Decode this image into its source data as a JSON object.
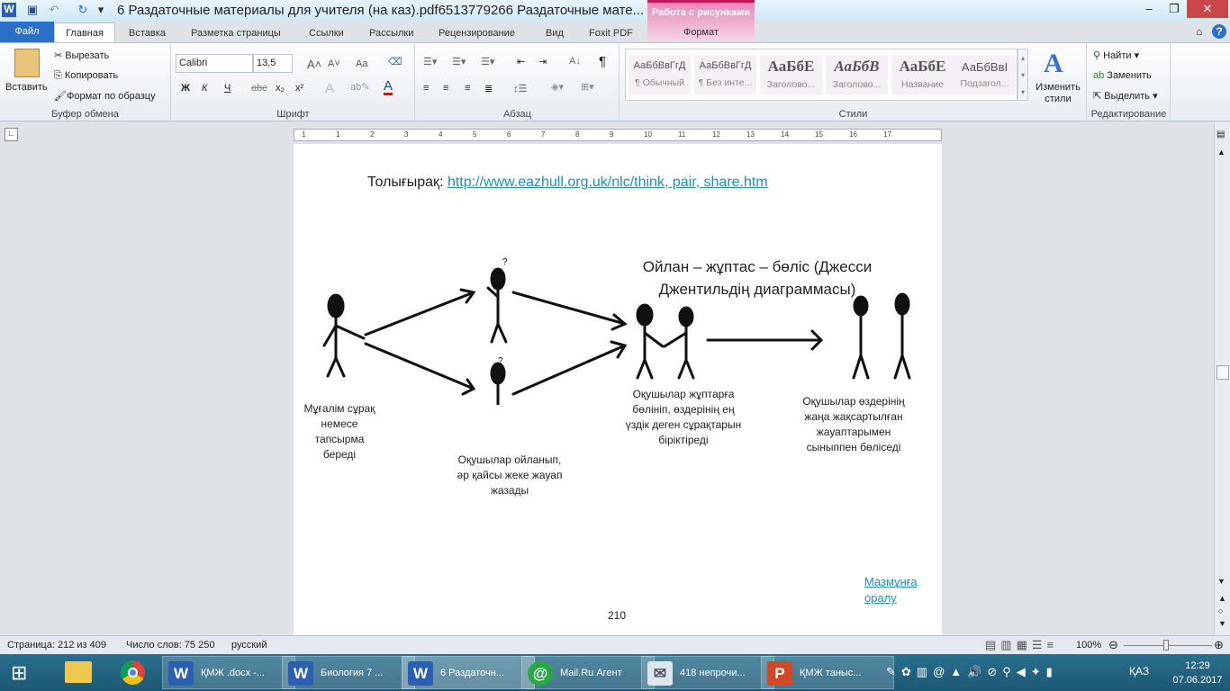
{
  "window": {
    "title": "6 Раздаточные материалы для учителя (на каз).pdf6513779266 Раздаточные мате...",
    "context_tab_group": "Работа с рисунками",
    "context_tab": "Формат",
    "app_icon": "word-icon",
    "minimize": "–",
    "restore": "❐",
    "close": "✕"
  },
  "tabs": [
    {
      "label": "Файл"
    },
    {
      "label": "Главная"
    },
    {
      "label": "Вставка"
    },
    {
      "label": "Разметка страницы"
    },
    {
      "label": "Ссылки"
    },
    {
      "label": "Рассылки"
    },
    {
      "label": "Рецензирование"
    },
    {
      "label": "Вид"
    },
    {
      "label": "Foxit PDF"
    }
  ],
  "ribbon": {
    "clipboard": {
      "label": "Буфер обмена",
      "paste": "Вставить",
      "cut": "Вырезать",
      "copy": "Копировать",
      "format_painter": "Формат по образцу"
    },
    "font": {
      "label": "Шрифт",
      "font_name": "Calibri",
      "font_size": "13,5",
      "bold": "Ж",
      "italic": "К",
      "underline": "Ч",
      "strike": "abc",
      "sub": "x₂",
      "sup": "x²",
      "grow": "A˄",
      "shrink": "A˅",
      "case": "Aa",
      "font_color": "A",
      "font_color_hex": "#e01010"
    },
    "paragraph": {
      "label": "Абзац",
      "pilcrow": "¶"
    },
    "styles": {
      "label": "Стили",
      "items": [
        {
          "sample": "АаБбВвГгД",
          "name": "¶ Обычный"
        },
        {
          "sample": "АаБбВвГгД",
          "name": "¶ Без инте..."
        },
        {
          "sample": "АаБбЕ",
          "name": "Заголово..."
        },
        {
          "sample": "АаБбВ",
          "name": "Заголово..."
        },
        {
          "sample": "АаБбЕ",
          "name": "Название"
        },
        {
          "sample": "АаБбВвІ",
          "name": "Подзагол..."
        }
      ],
      "change_styles": "Изменить стили"
    },
    "editing": {
      "label": "Редактирование",
      "find": "Найти",
      "replace": "Заменить",
      "select": "Выделить"
    }
  },
  "ruler": {
    "ticks": [
      "1",
      "1",
      "2",
      "3",
      "4",
      "5",
      "6",
      "7",
      "8",
      "9",
      "10",
      "11",
      "12",
      "13",
      "14",
      "15",
      "16",
      "17"
    ]
  },
  "document": {
    "more_label": "Толығырақ:",
    "more_link": "http://www.eazhull.org.uk/nlc/think, pair, share.htm",
    "diagram_title_1": "Ойлан – жұптас – бөліс (Джесси",
    "diagram_title_2": "Джентильдің диаграммасы)",
    "caption_teacher": "Мұғалім сұрақ немесе тапсырма береді",
    "caption_think": "Оқушылар ойланып, әр қайсы жеке жауап жазады",
    "caption_pair": "Оқушылар жұптарға бөлініп, өздерінің ең үздік деген сұрақтарын біріктіреді",
    "caption_share": "Оқушылар өздерінің жаңа жақсартылған жауаптарымен сыныппен бөліседі",
    "back_link_1": "Мазмұнға",
    "back_link_2": "оралу",
    "page_number": "210"
  },
  "status": {
    "page": "Страница: 212 из 409",
    "words": "Число слов: 75 250",
    "language": "русский",
    "zoom": "100%",
    "zoom_percent": 100
  },
  "taskbar": {
    "items": [
      {
        "label": "ҚМЖ .docx -...",
        "icon": "word-icon",
        "color": "#2b5fb4"
      },
      {
        "label": "Биология 7 ...",
        "icon": "word-icon",
        "color": "#2b5fb4"
      },
      {
        "label": "6 Раздаточн...",
        "icon": "word-icon",
        "color": "#2b5fb4",
        "active": true
      },
      {
        "label": "Mail.Ru Агент",
        "icon": "mailru-agent-icon",
        "color": "#27a845"
      },
      {
        "label": "418 непрочи...",
        "icon": "mail-envelope-icon",
        "color": "#dfe6ee"
      },
      {
        "label": "ҚМЖ таныс...",
        "icon": "powerpoint-icon",
        "color": "#d24726"
      }
    ],
    "language": "ҚАЗ",
    "time": "12:29",
    "date": "07.06.2017"
  }
}
